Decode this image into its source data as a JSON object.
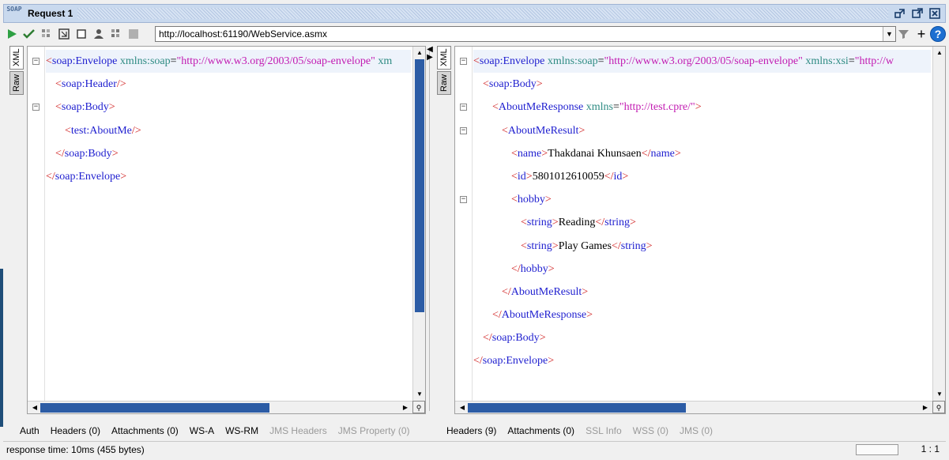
{
  "window": {
    "title": "Request 1",
    "logo_text": "SOAP"
  },
  "toolbar": {
    "url": "http://localhost:61190/WebService.asmx"
  },
  "request": {
    "tabs": [
      "XML",
      "Raw"
    ],
    "lines": [
      [
        {
          "c": "b",
          "s": "<"
        },
        {
          "c": "t",
          "s": "soap:Envelope"
        },
        {
          "c": "a",
          "s": " xmlns:soap"
        },
        {
          "c": "x",
          "s": "="
        },
        {
          "c": "v",
          "s": "\"http://www.w3.org/2003/05/soap-envelope\""
        },
        {
          "c": "x",
          "s": " "
        },
        {
          "c": "a",
          "s": "xm"
        }
      ],
      [
        {
          "c": "b",
          "s": "<"
        },
        {
          "c": "t",
          "s": "soap:Header"
        },
        {
          "c": "b",
          "s": "/>"
        }
      ],
      [
        {
          "c": "b",
          "s": "<"
        },
        {
          "c": "t",
          "s": "soap:Body"
        },
        {
          "c": "b",
          "s": ">"
        }
      ],
      [
        {
          "c": "b",
          "s": "<"
        },
        {
          "c": "t",
          "s": "test:AboutMe"
        },
        {
          "c": "b",
          "s": "/>"
        }
      ],
      [
        {
          "c": "b",
          "s": "</"
        },
        {
          "c": "t",
          "s": "soap:Body"
        },
        {
          "c": "b",
          "s": ">"
        }
      ],
      [
        {
          "c": "b",
          "s": "</"
        },
        {
          "c": "t",
          "s": "soap:Envelope"
        },
        {
          "c": "b",
          "s": ">"
        }
      ]
    ],
    "bottom_tabs": [
      {
        "label": "Auth",
        "enabled": true
      },
      {
        "label": "Headers (0)",
        "enabled": true
      },
      {
        "label": "Attachments (0)",
        "enabled": true
      },
      {
        "label": "WS-A",
        "enabled": true
      },
      {
        "label": "WS-RM",
        "enabled": true
      },
      {
        "label": "JMS Headers",
        "enabled": false
      },
      {
        "label": "JMS Property (0)",
        "enabled": false
      }
    ]
  },
  "response": {
    "tabs": [
      "XML",
      "Raw"
    ],
    "lines": [
      [
        {
          "c": "b",
          "s": "<"
        },
        {
          "c": "t",
          "s": "soap:Envelope"
        },
        {
          "c": "a",
          "s": " xmlns:soap"
        },
        {
          "c": "x",
          "s": "="
        },
        {
          "c": "v",
          "s": "\"http://www.w3.org/2003/05/soap-envelope\""
        },
        {
          "c": "a",
          "s": " xmlns:xsi"
        },
        {
          "c": "x",
          "s": "="
        },
        {
          "c": "v",
          "s": "\"http://w"
        }
      ],
      [
        {
          "c": "b",
          "s": "<"
        },
        {
          "c": "t",
          "s": "soap:Body"
        },
        {
          "c": "b",
          "s": ">"
        }
      ],
      [
        {
          "c": "b",
          "s": "<"
        },
        {
          "c": "t",
          "s": "AboutMeResponse"
        },
        {
          "c": "a",
          "s": " xmlns"
        },
        {
          "c": "x",
          "s": "="
        },
        {
          "c": "v",
          "s": "\"http://test.cpre/\""
        },
        {
          "c": "b",
          "s": ">"
        }
      ],
      [
        {
          "c": "b",
          "s": "<"
        },
        {
          "c": "t",
          "s": "AboutMeResult"
        },
        {
          "c": "b",
          "s": ">"
        }
      ],
      [
        {
          "c": "b",
          "s": "<"
        },
        {
          "c": "t",
          "s": "name"
        },
        {
          "c": "b",
          "s": ">"
        },
        {
          "c": "x",
          "s": "Thakdanai Khunsaen"
        },
        {
          "c": "b",
          "s": "</"
        },
        {
          "c": "t",
          "s": "name"
        },
        {
          "c": "b",
          "s": ">"
        }
      ],
      [
        {
          "c": "b",
          "s": "<"
        },
        {
          "c": "t",
          "s": "id"
        },
        {
          "c": "b",
          "s": ">"
        },
        {
          "c": "x",
          "s": "5801012610059"
        },
        {
          "c": "b",
          "s": "</"
        },
        {
          "c": "t",
          "s": "id"
        },
        {
          "c": "b",
          "s": ">"
        }
      ],
      [
        {
          "c": "b",
          "s": "<"
        },
        {
          "c": "t",
          "s": "hobby"
        },
        {
          "c": "b",
          "s": ">"
        }
      ],
      [
        {
          "c": "b",
          "s": "<"
        },
        {
          "c": "t",
          "s": "string"
        },
        {
          "c": "b",
          "s": ">"
        },
        {
          "c": "x",
          "s": "Reading"
        },
        {
          "c": "b",
          "s": "</"
        },
        {
          "c": "t",
          "s": "string"
        },
        {
          "c": "b",
          "s": ">"
        }
      ],
      [
        {
          "c": "b",
          "s": "<"
        },
        {
          "c": "t",
          "s": "string"
        },
        {
          "c": "b",
          "s": ">"
        },
        {
          "c": "x",
          "s": "Play Games"
        },
        {
          "c": "b",
          "s": "</"
        },
        {
          "c": "t",
          "s": "string"
        },
        {
          "c": "b",
          "s": ">"
        }
      ],
      [
        {
          "c": "b",
          "s": "</"
        },
        {
          "c": "t",
          "s": "hobby"
        },
        {
          "c": "b",
          "s": ">"
        }
      ],
      [
        {
          "c": "b",
          "s": "</"
        },
        {
          "c": "t",
          "s": "AboutMeResult"
        },
        {
          "c": "b",
          "s": ">"
        }
      ],
      [
        {
          "c": "b",
          "s": "</"
        },
        {
          "c": "t",
          "s": "AboutMeResponse"
        },
        {
          "c": "b",
          "s": ">"
        }
      ],
      [
        {
          "c": "b",
          "s": "</"
        },
        {
          "c": "t",
          "s": "soap:Body"
        },
        {
          "c": "b",
          "s": ">"
        }
      ],
      [
        {
          "c": "b",
          "s": "</"
        },
        {
          "c": "t",
          "s": "soap:Envelope"
        },
        {
          "c": "b",
          "s": ">"
        }
      ]
    ],
    "bottom_tabs": [
      {
        "label": "Headers (9)",
        "enabled": true
      },
      {
        "label": "Attachments (0)",
        "enabled": true
      },
      {
        "label": "SSL Info",
        "enabled": false
      },
      {
        "label": "WSS (0)",
        "enabled": false
      },
      {
        "label": "JMS (0)",
        "enabled": false
      }
    ]
  },
  "status": {
    "response_time": "response time: 10ms (455 bytes)",
    "position": "1 : 1"
  }
}
